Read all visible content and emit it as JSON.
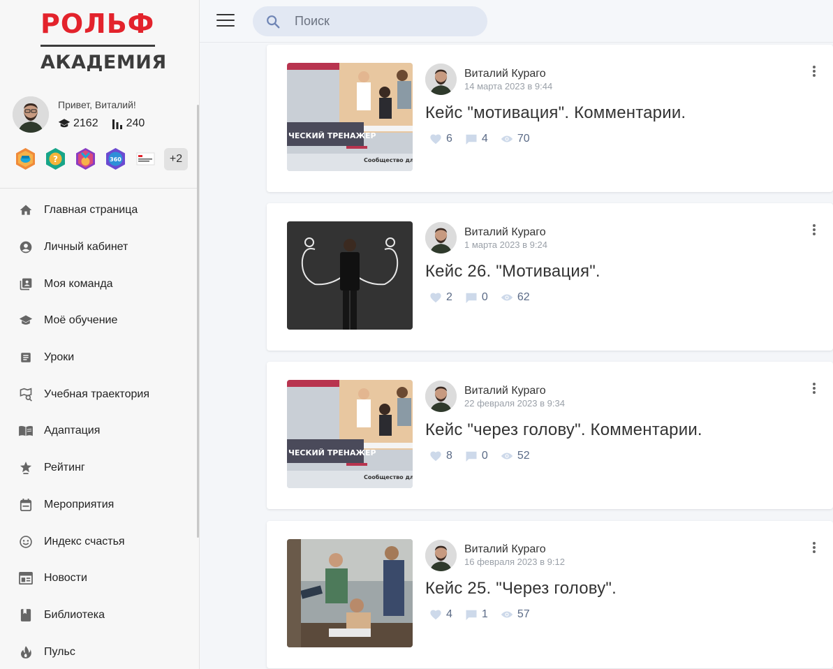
{
  "brand": {
    "top": "РОЛЬФ",
    "bottom": "АКАДЕМИЯ"
  },
  "profile": {
    "greeting": "Привет, Виталий!",
    "courses": "2162",
    "rating": "240"
  },
  "badges": {
    "more": "+2"
  },
  "nav": [
    {
      "label": "Главная страница",
      "icon": "home-icon"
    },
    {
      "label": "Личный кабинет",
      "icon": "account-icon"
    },
    {
      "label": "Моя команда",
      "icon": "team-icon"
    },
    {
      "label": "Моё обучение",
      "icon": "graduation-cap-icon"
    },
    {
      "label": "Уроки",
      "icon": "lessons-icon"
    },
    {
      "label": "Учебная траектория",
      "icon": "map-search-icon"
    },
    {
      "label": "Адаптация",
      "icon": "book-open-icon"
    },
    {
      "label": "Рейтинг",
      "icon": "trophy-star-icon"
    },
    {
      "label": "Мероприятия",
      "icon": "calendar-icon"
    },
    {
      "label": "Индекс счастья",
      "icon": "smile-icon"
    },
    {
      "label": "Новости",
      "icon": "news-icon"
    },
    {
      "label": "Библиотека",
      "icon": "bookmark-book-icon"
    },
    {
      "label": "Пульс",
      "icon": "fire-icon"
    }
  ],
  "search": {
    "placeholder": "Поиск"
  },
  "posts": [
    {
      "author": "Виталий Кураго",
      "date": "14 марта 2023 в 9:44",
      "title": "Кейс \"мотивация\". Комментарии.",
      "likes": "6",
      "comments": "4",
      "views": "70",
      "thumb_text": "ЧЕСКИЙ ТРЕНАЖЕР",
      "thumb_caption": "Сообщество дл"
    },
    {
      "author": "Виталий Кураго",
      "date": "1 марта 2023 в 9:24",
      "title": "Кейс 26. \"Мотивация\".",
      "likes": "2",
      "comments": "0",
      "views": "62"
    },
    {
      "author": "Виталий Кураго",
      "date": "22 февраля 2023 в 9:34",
      "title": "Кейс \"через голову\". Комментарии.",
      "likes": "8",
      "comments": "0",
      "views": "52",
      "thumb_text": "ЧЕСКИЙ ТРЕНАЖЕР",
      "thumb_caption": "Сообщество дл"
    },
    {
      "author": "Виталий Кураго",
      "date": "16 февраля 2023 в 9:12",
      "title": "Кейс 25. \"Через голову\".",
      "likes": "4",
      "comments": "1",
      "views": "57"
    }
  ],
  "colors": {
    "brand_red": "#e3232c",
    "accent": "#5a6a86",
    "search_bg": "#e2e8f3"
  }
}
